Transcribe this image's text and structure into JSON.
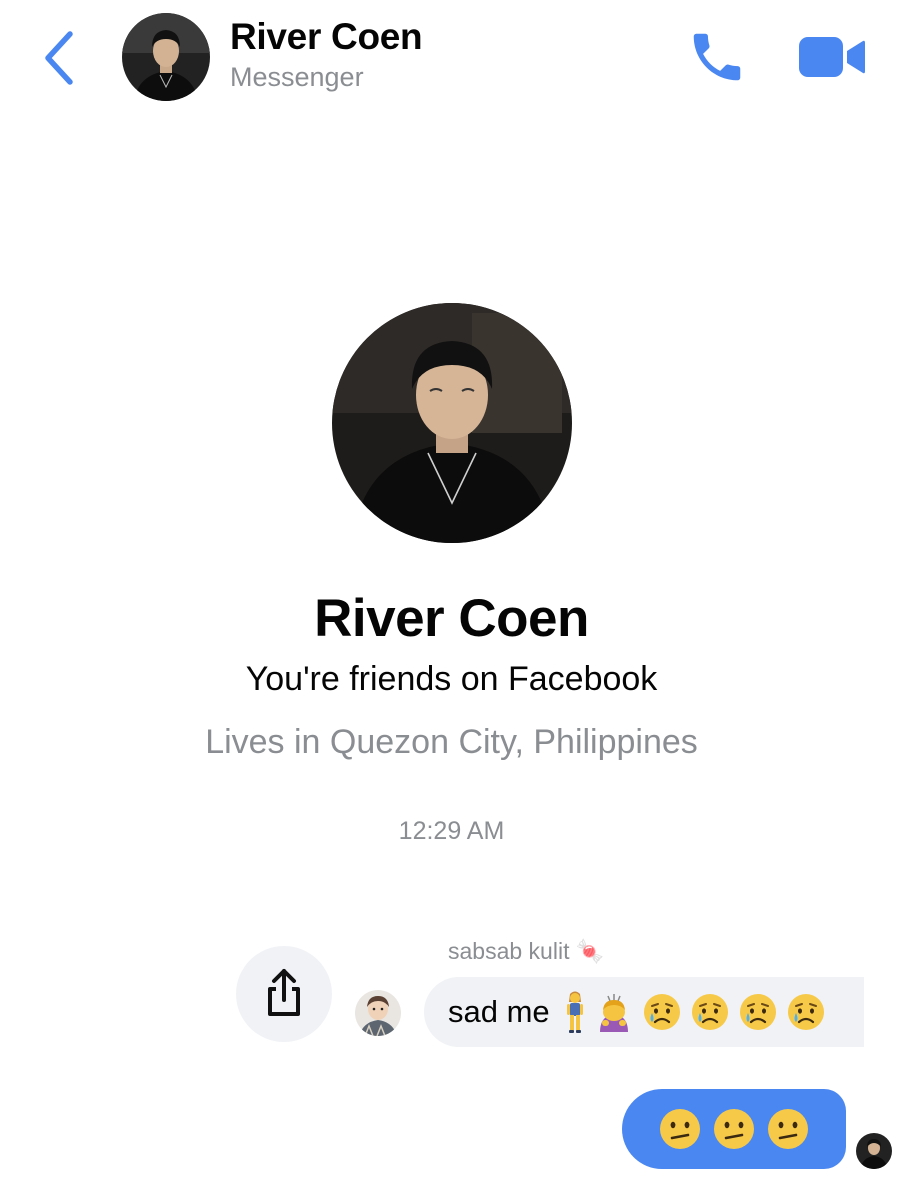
{
  "header": {
    "name": "River Coen",
    "subtitle": "Messenger",
    "icons": {
      "back": "chevron-left-icon",
      "call": "phone-icon",
      "video": "video-camera-icon"
    },
    "accent_color": "#4a87f0"
  },
  "profile": {
    "name": "River Coen",
    "friends_text": "You're friends on Facebook",
    "location_text": "Lives in Quezon City, Philippines"
  },
  "conversation": {
    "timestamp": "12:29 AM",
    "incoming": {
      "sender_name": "sabsab kulit 🍬",
      "text": "sad me",
      "emojis": [
        "person-standing-emoji",
        "person-bowing-emoji",
        "sad-relieved-face-emoji",
        "sad-relieved-face-emoji",
        "sad-relieved-face-emoji",
        "sad-relieved-face-emoji"
      ],
      "share_icon": "share-icon",
      "bubble_color": "#f0f2f5"
    },
    "outgoing": {
      "emojis": [
        "confused-face-emoji",
        "confused-face-emoji",
        "confused-face-emoji"
      ],
      "bubble_color": "#4a87f0"
    }
  }
}
